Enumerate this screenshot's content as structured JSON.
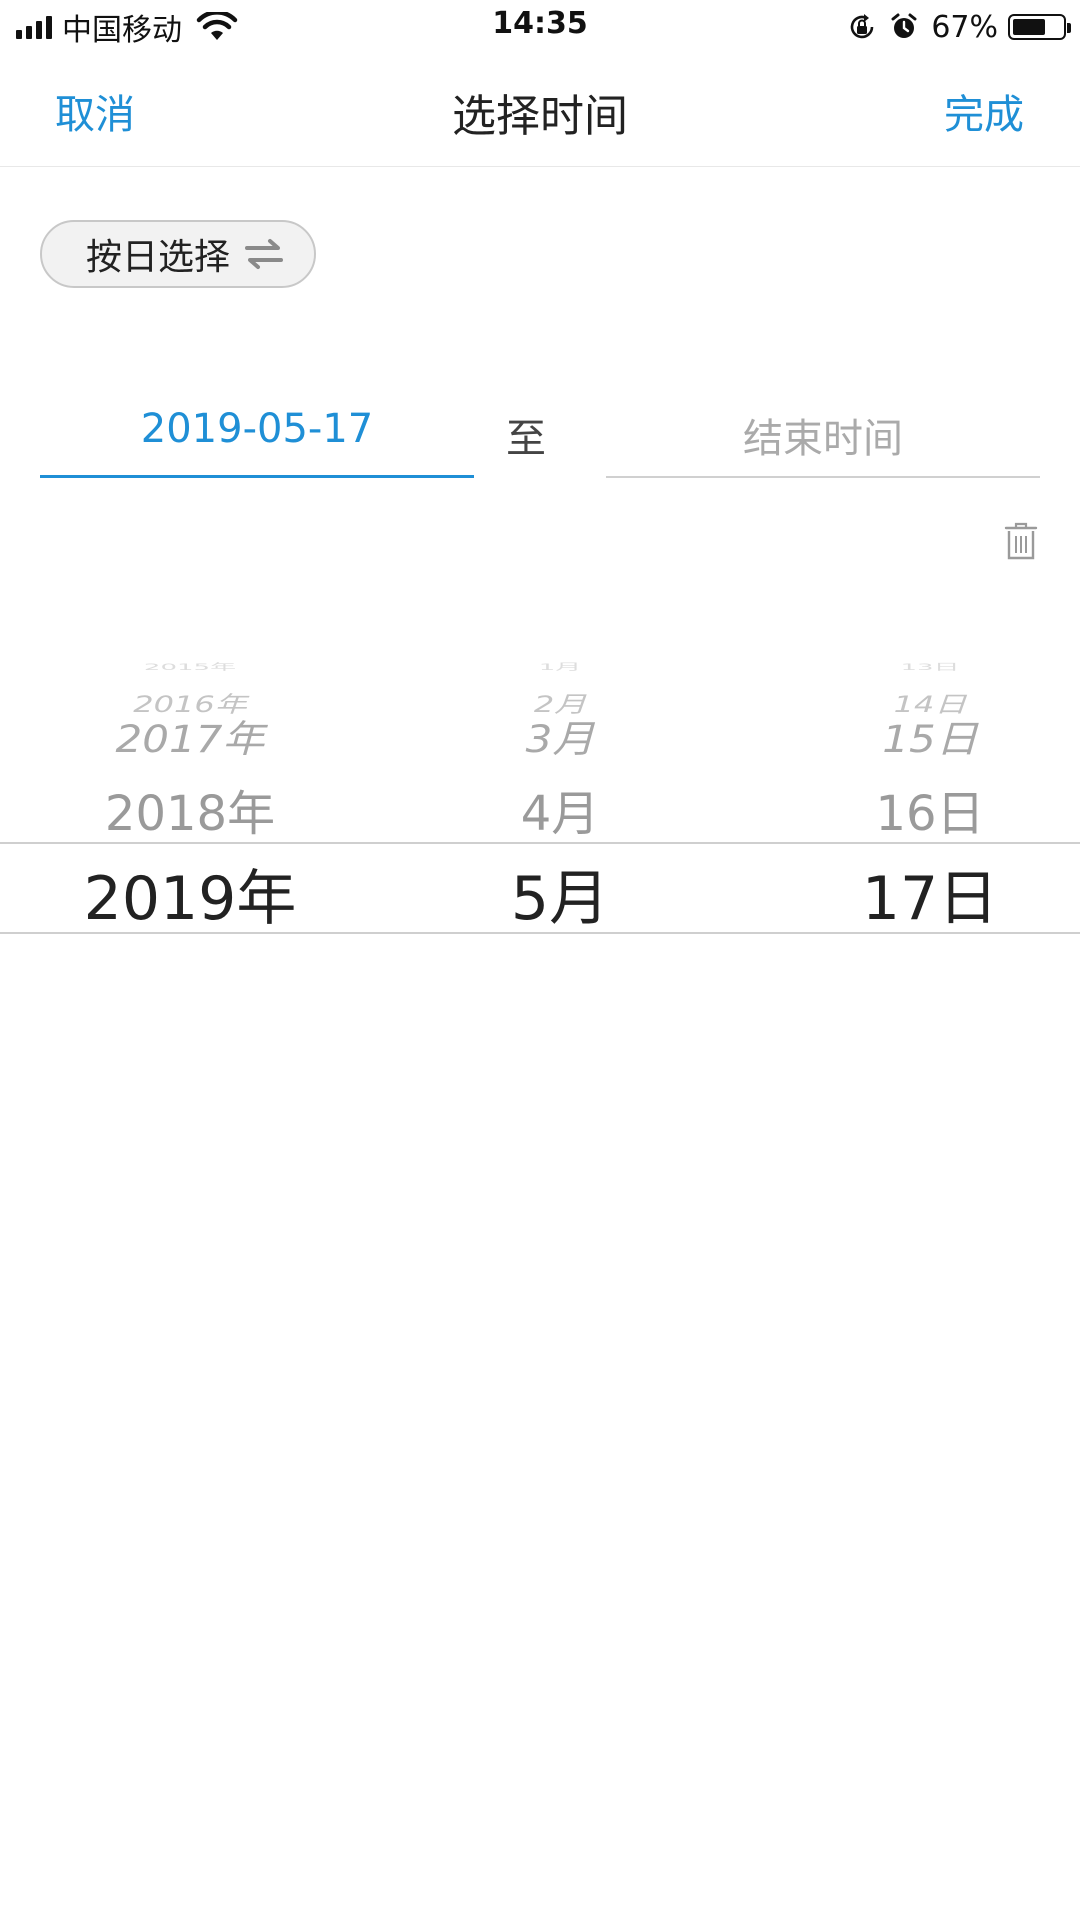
{
  "status_bar": {
    "carrier": "中国移动",
    "time": "14:35",
    "battery_percent": "67%",
    "battery_level": 0.67,
    "icons": [
      "signal-icon",
      "wifi-icon",
      "rotation-lock-icon",
      "alarm-icon",
      "battery-icon"
    ]
  },
  "nav": {
    "cancel": "取消",
    "title": "选择时间",
    "done": "完成"
  },
  "mode_toggle": {
    "label": "按日选择",
    "icon": "swap-icon"
  },
  "range": {
    "start": "2019-05-17",
    "separator": "至",
    "end_placeholder": "结束时间"
  },
  "picker": {
    "years": [
      "2015年",
      "2016年",
      "2017年",
      "2018年",
      "2019年"
    ],
    "months": [
      "1月",
      "2月",
      "3月",
      "4月",
      "5月"
    ],
    "days": [
      "13日",
      "14日",
      "15日",
      "16日",
      "17日"
    ],
    "selected": {
      "year": "2019年",
      "month": "5月",
      "day": "17日"
    }
  },
  "colors": {
    "accent": "#1f8fd6",
    "text": "#222222",
    "placeholder": "#aaaaaa"
  }
}
